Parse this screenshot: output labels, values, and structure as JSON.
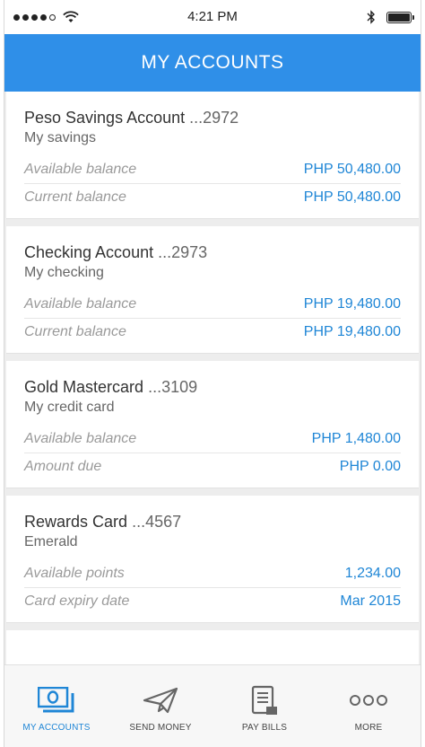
{
  "status_bar": {
    "time": "4:21 PM"
  },
  "header": {
    "title": "MY ACCOUNTS"
  },
  "accounts": [
    {
      "name": "Peso Savings Account",
      "number": "...2972",
      "nickname": "My savings",
      "rows": [
        {
          "label": "Available balance",
          "value": "PHP 50,480.00"
        },
        {
          "label": "Current balance",
          "value": "PHP 50,480.00"
        }
      ]
    },
    {
      "name": "Checking Account",
      "number": "...2973",
      "nickname": "My checking",
      "rows": [
        {
          "label": "Available balance",
          "value": "PHP 19,480.00"
        },
        {
          "label": "Current balance",
          "value": "PHP 19,480.00"
        }
      ]
    },
    {
      "name": "Gold Mastercard",
      "number": "...3109",
      "nickname": "My credit card",
      "rows": [
        {
          "label": "Available balance",
          "value": "PHP 1,480.00"
        },
        {
          "label": "Amount due",
          "value": "PHP 0.00"
        }
      ]
    },
    {
      "name": "Rewards Card",
      "number": "...4567",
      "nickname": "Emerald",
      "rows": [
        {
          "label": "Available points",
          "value": "1,234.00"
        },
        {
          "label": "Card expiry date",
          "value": "Mar 2015"
        }
      ]
    }
  ],
  "bottom_nav": [
    {
      "label": "MY ACCOUNTS",
      "icon": "money-icon",
      "active": true
    },
    {
      "label": "SEND MONEY",
      "icon": "paper-plane-icon",
      "active": false
    },
    {
      "label": "PAY BILLS",
      "icon": "bill-icon",
      "active": false
    },
    {
      "label": "MORE",
      "icon": "more-icon",
      "active": false
    }
  ],
  "colors": {
    "accent": "#2f8fe8",
    "value_blue": "#1f86d6",
    "label_gray": "#9a9a9a"
  }
}
